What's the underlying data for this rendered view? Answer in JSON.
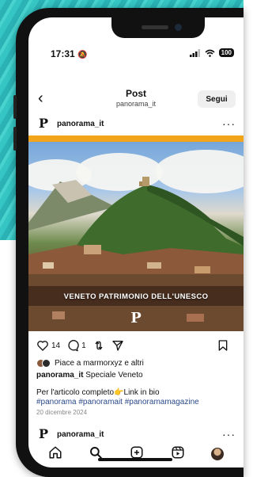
{
  "status_bar": {
    "time": "17:31",
    "battery": "100"
  },
  "nav": {
    "back_label": "‹",
    "title": "Post",
    "subtitle": "panorama_it",
    "follow_label": "Segui"
  },
  "post": {
    "username": "panorama_it",
    "more_label": "···",
    "image_banner": "VENETO PATRIMONIO DELL'UNESCO",
    "logo_letter": "P",
    "likes_count": "14",
    "comments_count": "1",
    "liked_by": "Piace a marmorxyz e altri",
    "caption_user": "panorama_it",
    "caption_text": "Speciale Veneto",
    "caption_line2": "Per l'articolo completo👉Link in bio",
    "hashtags": "#panorama #panoramait #panoramamagazine",
    "date": "20 dicembre 2024"
  },
  "next_post": {
    "username": "panorama_it",
    "more_label": "···",
    "logo_letter": "P"
  },
  "tabbar": {
    "items": [
      "home-icon",
      "search-icon",
      "create-icon",
      "reels-icon",
      "profile-avatar"
    ]
  },
  "colors": {
    "banner_bar": "#f2a51b",
    "hashtag": "#2b4a8a"
  }
}
